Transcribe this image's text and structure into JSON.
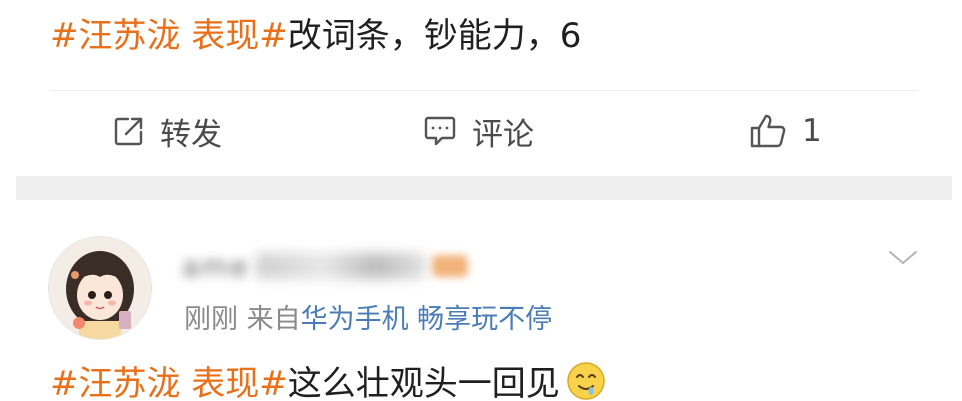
{
  "post1": {
    "hashtag": "#汪苏泷 表现#",
    "text": "改词条，钞能力，6"
  },
  "actions": {
    "repost_label": "转发",
    "comment_label": "评论",
    "like_count": "1"
  },
  "comment": {
    "username": "ame",
    "meta_time": "刚刚",
    "meta_from": "来自",
    "meta_device": "华为手机 畅享玩不停",
    "hashtag": "#汪苏泷 表现#",
    "text": "这么壮观头一回见",
    "emoji": "drooling-face-emoji"
  },
  "colors": {
    "hashtag": "#e8701a",
    "link": "#4a7db5",
    "meta": "#8a8a8a",
    "band": "#efefef"
  },
  "icons": {
    "repost": "share-box-icon",
    "comment": "comment-bubble-icon",
    "like": "thumbs-up-icon",
    "more": "chevron-down-icon"
  }
}
